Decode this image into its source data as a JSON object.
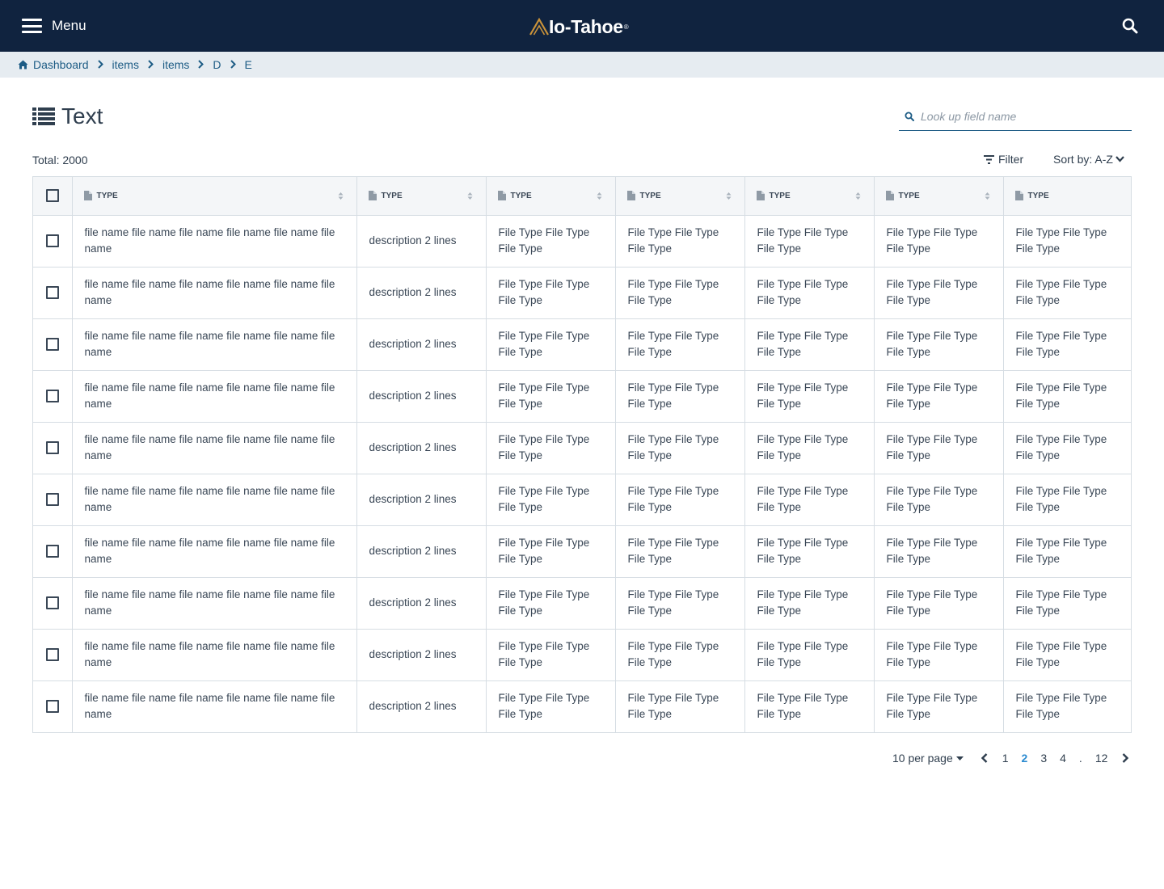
{
  "header": {
    "menu_label": "Menu",
    "logo_text": "Io-Tahoe",
    "logo_mark": "®",
    "colors": {
      "bar": "#10233f",
      "accent": "#c9923a"
    }
  },
  "breadcrumb": [
    "Dashboard",
    "items",
    "items",
    "D",
    "E"
  ],
  "page": {
    "title": "Text",
    "search_placeholder": "Look up field name",
    "total": "Total: 2000",
    "filter_label": "Filter",
    "sort_label": "Sort by: A-Z"
  },
  "table": {
    "columns": [
      "TYPE",
      "TYPE",
      "TYPE",
      "TYPE",
      "TYPE",
      "TYPE",
      "TYPE"
    ],
    "rows": [
      {
        "name": "file name file name file name file name file name file name",
        "description": "description 2 lines",
        "t1": "File Type File Type File Type",
        "t2": "File Type File Type File Type",
        "t3": "File Type File Type File Type",
        "t4": "File Type File Type File Type",
        "t5": "File Type File Type File Type"
      },
      {
        "name": "file name file name file name file name file name file name",
        "description": "description 2 lines",
        "t1": "File Type File Type File Type",
        "t2": "File Type File Type File Type",
        "t3": "File Type File Type File Type",
        "t4": "File Type File Type File Type",
        "t5": "File Type File Type File Type"
      },
      {
        "name": "file name file name file name file name file name file name",
        "description": "description 2 lines",
        "t1": "File Type File Type File Type",
        "t2": "File Type File Type File Type",
        "t3": "File Type File Type File Type",
        "t4": "File Type File Type File Type",
        "t5": "File Type File Type File Type"
      },
      {
        "name": "file name file name file name file name file name file name",
        "description": "description 2 lines",
        "t1": "File Type File Type File Type",
        "t2": "File Type File Type File Type",
        "t3": "File Type File Type File Type",
        "t4": "File Type File Type File Type",
        "t5": "File Type File Type File Type"
      },
      {
        "name": "file name file name file name file name file name file name",
        "description": "description 2 lines",
        "t1": "File Type File Type File Type",
        "t2": "File Type File Type File Type",
        "t3": "File Type File Type File Type",
        "t4": "File Type File Type File Type",
        "t5": "File Type File Type File Type"
      },
      {
        "name": "file name file name file name file name file name file name",
        "description": "description 2 lines",
        "t1": "File Type File Type File Type",
        "t2": "File Type File Type File Type",
        "t3": "File Type File Type File Type",
        "t4": "File Type File Type File Type",
        "t5": "File Type File Type File Type"
      },
      {
        "name": "file name file name file name file name file name file name",
        "description": "description 2 lines",
        "t1": "File Type File Type File Type",
        "t2": "File Type File Type File Type",
        "t3": "File Type File Type File Type",
        "t4": "File Type File Type File Type",
        "t5": "File Type File Type File Type"
      },
      {
        "name": "file name file name file name file name file name file name",
        "description": "description 2 lines",
        "t1": "File Type File Type File Type",
        "t2": "File Type File Type File Type",
        "t3": "File Type File Type File Type",
        "t4": "File Type File Type File Type",
        "t5": "File Type File Type File Type"
      },
      {
        "name": "file name file name file name file name file name file name",
        "description": "description 2 lines",
        "t1": "File Type File Type File Type",
        "t2": "File Type File Type File Type",
        "t3": "File Type File Type File Type",
        "t4": "File Type File Type File Type",
        "t5": "File Type File Type File Type"
      },
      {
        "name": "file name file name file name file name file name file name",
        "description": "description 2 lines",
        "t1": "File Type File Type File Type",
        "t2": "File Type File Type File Type",
        "t3": "File Type File Type File Type",
        "t4": "File Type File Type File Type",
        "t5": "File Type File Type File Type"
      }
    ]
  },
  "pagination": {
    "per_page": "10 per page",
    "pages": [
      "1",
      "2",
      "3",
      "4"
    ],
    "active_page": "2",
    "ellipsis": ".",
    "last_page": "12"
  }
}
